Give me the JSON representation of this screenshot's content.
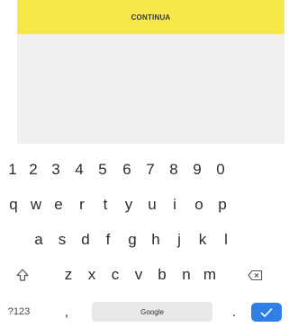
{
  "header": {
    "continue_label": "CONTINUA",
    "accent": "#f7e84a"
  },
  "keyboard": {
    "numbers": [
      "1",
      "2",
      "3",
      "4",
      "5",
      "6",
      "7",
      "8",
      "9",
      "0"
    ],
    "row_q": [
      "q",
      "w",
      "e",
      "r",
      "t",
      "y",
      "u",
      "i",
      "o",
      "p"
    ],
    "row_a": [
      "a",
      "s",
      "d",
      "f",
      "g",
      "h",
      "j",
      "k",
      "l"
    ],
    "row_z": [
      "z",
      "x",
      "c",
      "v",
      "b",
      "n",
      "m"
    ],
    "symbols_label": "?123",
    "comma": ",",
    "space_label": "Google",
    "period": ".",
    "enter_color": "#2f7fe6",
    "icons": {
      "shift": "shift-icon",
      "backspace": "backspace-icon",
      "enter": "check-icon"
    }
  }
}
